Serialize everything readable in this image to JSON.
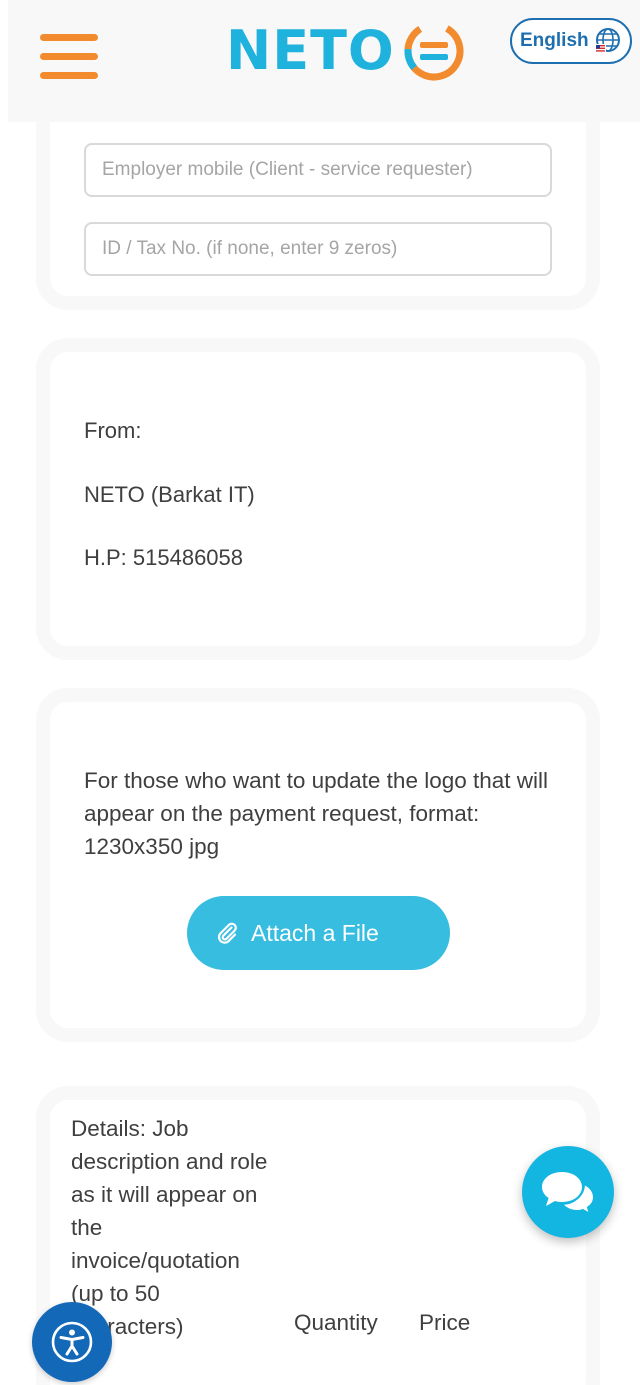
{
  "header": {
    "logo_text": "NETO",
    "language_label": "English"
  },
  "client_form": {
    "mobile_placeholder": "Employer mobile (Client - service requester)",
    "tax_placeholder": "ID / Tax No. (if none, enter 9 zeros)"
  },
  "from_section": {
    "label": "From:",
    "company": "NETO (Barkat IT)",
    "hp": "H.P: 515486058"
  },
  "logo_section": {
    "note": "For those who want to update the logo that will appear on the payment request, format: 1230x350 jpg",
    "attach_label": "Attach a File"
  },
  "details_section": {
    "details_label": "Details: Job description and role as it will appear on the invoice/quotation (up to 50 characters)",
    "quantity_label": "Quantity",
    "price_label": "Price"
  },
  "colors": {
    "brand_blue": "#1fb2dd",
    "brand_orange": "#f28a2e",
    "attach_button": "#36bde0",
    "chat_fab": "#13b6e0",
    "accessibility_fab": "#1468b8"
  },
  "icons": {
    "menu": "hamburger-menu-icon",
    "language": "globe-icon",
    "attach": "paperclip-icon",
    "chat": "chat-bubbles-icon",
    "accessibility": "accessibility-icon"
  }
}
